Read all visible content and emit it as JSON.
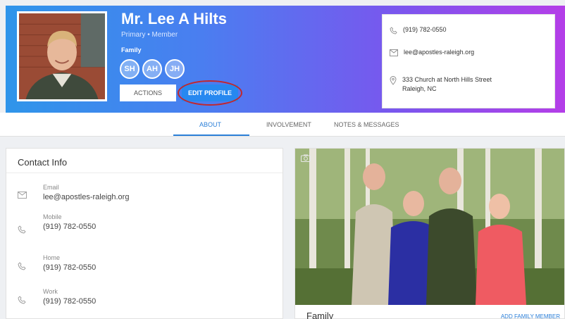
{
  "profile": {
    "name": "Mr. Lee A Hilts",
    "subtitle": "Primary • Member",
    "family_label": "Family",
    "members": [
      "SH",
      "AH",
      "JH"
    ],
    "actions_label": "ACTIONS",
    "edit_label": "EDIT PROFILE"
  },
  "contact_card": {
    "phone": "(919) 782-0550",
    "email": "lee@apostles-raleigh.org",
    "address_line1": "333 Church at North Hills Street",
    "address_line2": "Raleigh, NC"
  },
  "tabs": [
    {
      "label": "ABOUT",
      "active": true
    },
    {
      "label": "INVOLVEMENT",
      "active": false
    },
    {
      "label": "NOTES & MESSAGES",
      "active": false
    }
  ],
  "contact_info": {
    "title": "Contact Info",
    "rows": [
      {
        "label": "Email",
        "value": "lee@apostles-raleigh.org",
        "icon": "envelope-icon"
      },
      {
        "label": "Mobile",
        "value": "(919) 782-0550",
        "icon": "phone-icon"
      },
      {
        "label": "Home",
        "value": "(919) 782-0550",
        "icon": "phone-icon"
      },
      {
        "label": "Work",
        "value": "(919) 782-0550",
        "icon": "phone-icon"
      }
    ]
  },
  "family_card": {
    "title": "Family",
    "add_label": "ADD FAMILY MEMBER"
  },
  "colors": {
    "accent": "#2b7fd8",
    "header_start": "#2f95ea",
    "header_end": "#b43ee8",
    "highlight_ring": "#c1272d"
  }
}
